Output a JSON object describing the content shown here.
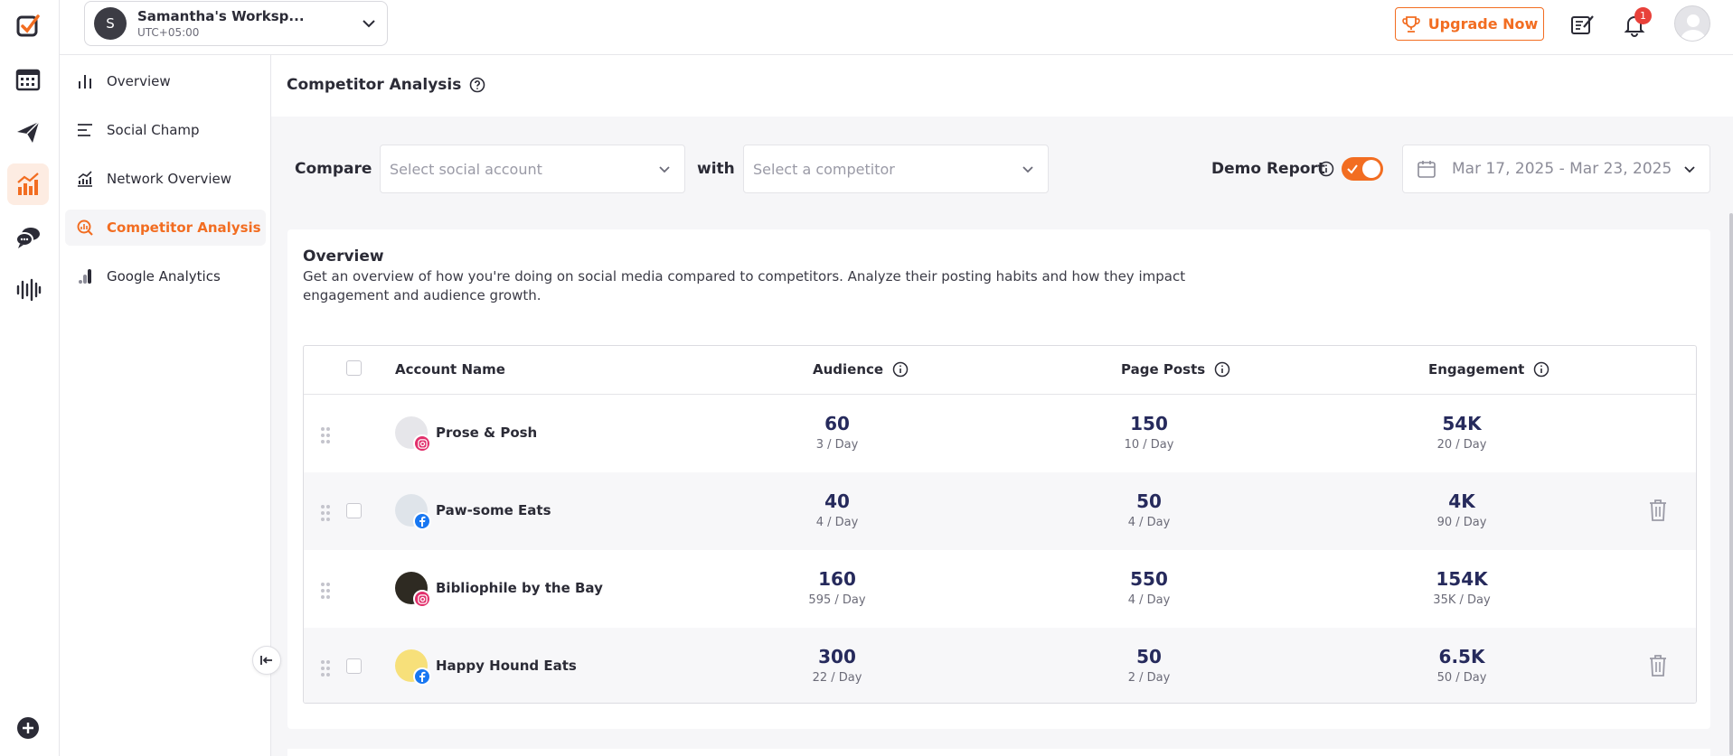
{
  "brand": {
    "accent": "#f26d21",
    "text": "#2b2b36",
    "value_color": "#262a5c"
  },
  "rail": {
    "icons": [
      "logo-icon",
      "calendar-icon",
      "send-icon",
      "analytics-icon",
      "chat-icon",
      "audio-wave-icon",
      "add-icon"
    ],
    "active": "analytics-icon"
  },
  "workspace": {
    "avatar_initial": "S",
    "name": "Samantha's Worksp...",
    "timezone": "UTC+05:00"
  },
  "topbar": {
    "upgrade_label": "Upgrade Now",
    "notification_count": "1"
  },
  "subnav": {
    "items": [
      {
        "label": "Overview",
        "icon": "bar-chart-icon"
      },
      {
        "label": "Social Champ",
        "icon": "lines-icon"
      },
      {
        "label": "Network Overview",
        "icon": "network-chart-icon"
      },
      {
        "label": "Competitor Analysis",
        "icon": "competitor-icon",
        "active": true
      },
      {
        "label": "Google Analytics",
        "icon": "google-analytics-icon"
      }
    ]
  },
  "page": {
    "title": "Competitor Analysis"
  },
  "filters": {
    "compare_label": "Compare",
    "account_placeholder": "Select social account",
    "with_label": "with",
    "competitor_placeholder": "Select a competitor",
    "demo_label": "Demo Report",
    "demo_on": true,
    "date_range": "Mar 17, 2025 - Mar 23, 2025"
  },
  "overview": {
    "title": "Overview",
    "description": "Get an overview of how you're doing on social media compared to competitors. Analyze their posting habits and how they impact engagement and audience growth.",
    "columns": {
      "account": "Account Name",
      "audience": "Audience",
      "posts": "Page Posts",
      "engagement": "Engagement"
    },
    "rows": [
      {
        "name": "Prose & Posh",
        "network": "instagram",
        "audience": "60",
        "audience_rate": "3 / Day",
        "posts": "150",
        "posts_rate": "10 / Day",
        "engagement": "54K",
        "engagement_rate": "20 / Day",
        "removable": false
      },
      {
        "name": "Paw-some Eats",
        "network": "facebook",
        "audience": "40",
        "audience_rate": "4 / Day",
        "posts": "50",
        "posts_rate": "4 / Day",
        "engagement": "4K",
        "engagement_rate": "90 / Day",
        "removable": true
      },
      {
        "name": "Bibliophile by the Bay",
        "network": "instagram",
        "audience": "160",
        "audience_rate": "595 / Day",
        "posts": "550",
        "posts_rate": "4 / Day",
        "engagement": "154K",
        "engagement_rate": "35K / Day",
        "removable": false
      },
      {
        "name": "Happy Hound Eats",
        "network": "facebook",
        "audience": "300",
        "audience_rate": "22 / Day",
        "posts": "50",
        "posts_rate": "2 / Day",
        "engagement": "6.5K",
        "engagement_rate": "50 / Day",
        "removable": true
      }
    ]
  }
}
